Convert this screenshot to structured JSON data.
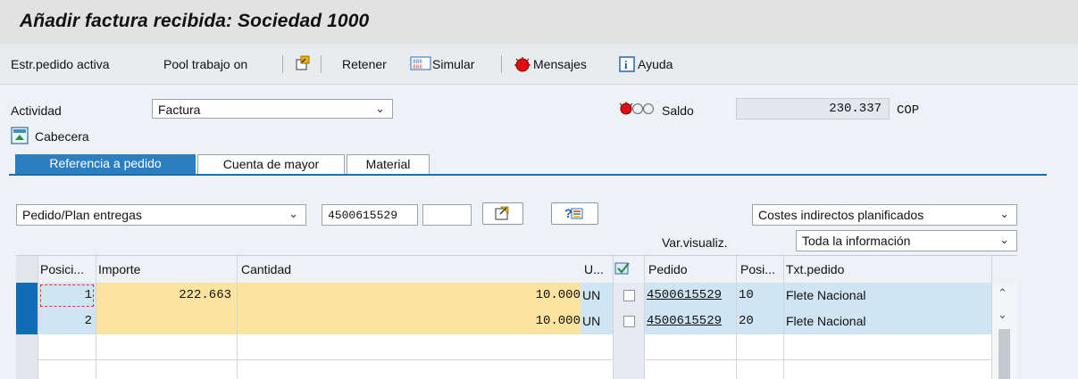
{
  "title": "Añadir factura recibida: Sociedad 1000",
  "toolbar": {
    "estr_pedido": "Estr.pedido activa",
    "pool": "Pool trabajo on",
    "retener": "Retener",
    "simular": "Simular",
    "mensajes": "Mensajes",
    "ayuda": "Ayuda"
  },
  "header": {
    "actividad_label": "Actividad",
    "actividad_value": "Factura",
    "saldo_label": "Saldo",
    "saldo_value": "230.337",
    "currency": "COP",
    "cabecera": "Cabecera"
  },
  "tabs": [
    {
      "label": "Referencia a pedido"
    },
    {
      "label": "Cuenta de mayor"
    },
    {
      "label": "Material"
    }
  ],
  "reference": {
    "type_value": "Pedido/Plan entregas",
    "po_number": "4500615529",
    "po_item": "",
    "costs_value": "Costes indirectos planificados",
    "var_visualiz_label": "Var.visualiz.",
    "var_visualiz_value": "Toda la información"
  },
  "table": {
    "headers": {
      "posicion": "Posici...",
      "importe": "Importe",
      "cantidad": "Cantidad",
      "unidad": "U...",
      "pedido": "Pedido",
      "posi": "Posi...",
      "txt_pedido": "Txt.pedido"
    },
    "rows": [
      {
        "pos": "1",
        "importe": "222.663",
        "cantidad": "10.000",
        "unidad": "UN",
        "pedido": "4500615529",
        "posi": "10",
        "txt": "Flete Nacional"
      },
      {
        "pos": "2",
        "importe": "",
        "cantidad": "10.000",
        "unidad": "UN",
        "pedido": "4500615529",
        "posi": "20",
        "txt": "Flete Nacional"
      }
    ]
  },
  "colors": {
    "tab_active": "#2b7fc1",
    "row_highlight": "#cfe5f3",
    "amount_field": "#fde3a0",
    "row_selector": "#0e6db5",
    "status_red": "#e01010"
  },
  "icons": {
    "pool_toggle": "export-icon",
    "simular": "simulate-icon",
    "mensajes": "red-message-icon",
    "ayuda": "info-icon",
    "cabecera": "header-toggle-icon",
    "status": "traffic-light-red-icon",
    "refresh": "transfer-icon",
    "search": "search-help-icon",
    "row_select": "checkbox-icon",
    "scroll_up": "chevron-up-icon",
    "scroll_down": "chevron-down-icon"
  }
}
